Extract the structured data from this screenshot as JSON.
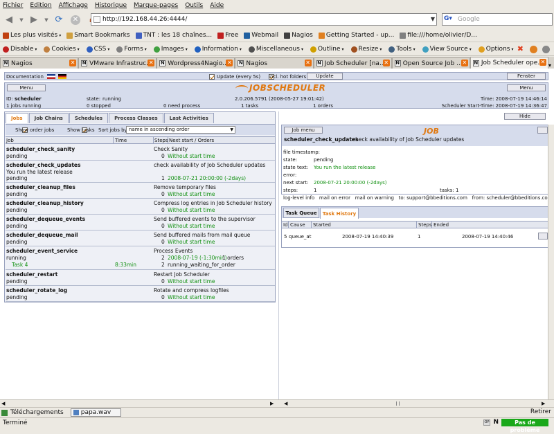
{
  "menu": [
    "Fichier",
    "Edition",
    "Affichage",
    "Historique",
    "Marque-pages",
    "Outils",
    "Aide"
  ],
  "url": "http://192.168.44.26:4444/",
  "search_placeholder": "Google",
  "bookmarks": [
    "Les plus visités",
    "Smart Bookmarks",
    "TNT : les 18 chaînes...",
    "Free",
    "Webmail",
    "Nagios",
    "Getting Started - up...",
    "file:///home/olivier/D..."
  ],
  "devbar": [
    "Disable",
    "Cookies",
    "CSS",
    "Forms",
    "Images",
    "Information",
    "Miscellaneous",
    "Outline",
    "Resize",
    "Tools",
    "View Source",
    "Options"
  ],
  "tabs": [
    "Nagios",
    "VMware Infrastruc...",
    "Wordpress4Nagio...",
    "Nagios",
    "Job Scheduler [na...",
    "Open Source Job ...",
    "Job Scheduler ope..."
  ],
  "top": {
    "documentation": "Documentation",
    "update_label": "Update (every 5s)",
    "hot_folders": "incl. hot folders",
    "update_btn": "Update",
    "fenster": "Fenster",
    "menu_btn": "Menu",
    "id_label": "ID:",
    "id_value": "scheduler",
    "state_label": "state:",
    "state_value": "running",
    "version": "2.0.206.5791 (2008-05-27 19:01:42)",
    "time_label": "Time: 2008-07-19 14:46:14",
    "jobs_running": "1 jobs running",
    "stopped": "0 stopped",
    "need_process": "0 need process",
    "tasks": "1 tasks",
    "orders": "1 orders",
    "start_time": "Scheduler Start-Time: 2008-07-19 14:36:47",
    "logo": "JOBSCHEDULER"
  },
  "hide_btn": "Hide",
  "left": {
    "tabs": [
      "Jobs",
      "Job Chains",
      "Schedules",
      "Process Classes",
      "Last Activities"
    ],
    "show_order_jobs": "Show order jobs",
    "show_tasks": "Show tasks",
    "sort_label": "Sort jobs by",
    "sort_value": "name in ascending order",
    "headers": {
      "job": "Job",
      "time": "Time",
      "steps": "Steps",
      "next": "Next start  / Orders"
    },
    "jobs": [
      {
        "name": "scheduler_check_sanity",
        "desc": "Check Sanity",
        "state": "pending",
        "steps": "0",
        "next": "Without start time"
      },
      {
        "name": "scheduler_check_updates",
        "desc": "check availability of Job Scheduler updates",
        "extra": "You run the latest release",
        "state": "pending",
        "steps": "1",
        "next": "2008-07-21  20:00:00  (-2days)"
      },
      {
        "name": "scheduler_cleanup_files",
        "desc": "Remove temporary files",
        "state": "pending",
        "steps": "0",
        "next": "Without start time"
      },
      {
        "name": "scheduler_cleanup_history",
        "desc": "Compress log entries in Job Scheduler history",
        "state": "pending",
        "steps": "0",
        "next": "Without start time"
      },
      {
        "name": "scheduler_dequeue_events",
        "desc": "Send buffered events to the supervisor",
        "state": "pending",
        "steps": "0",
        "next": "Without start time"
      },
      {
        "name": "scheduler_dequeue_mail",
        "desc": "Send buffered mails from mail queue",
        "state": "pending",
        "steps": "0",
        "next": "Without start time"
      },
      {
        "name": "scheduler_event_service",
        "desc": "Process Events",
        "state": "running",
        "steps": "2",
        "next": "2008-07-19  (-1:30min)",
        "orders": "1 orders",
        "task": "Task 4",
        "task_time": "8:33min",
        "task_steps": "2",
        "task_state": "running_waiting_for_order"
      },
      {
        "name": "scheduler_restart",
        "desc": "Restart Job Scheduler",
        "state": "pending",
        "steps": "0",
        "next": "Without start time"
      },
      {
        "name": "scheduler_rotate_log",
        "desc": "Rotate and compress logfiles",
        "state": "pending",
        "steps": "0",
        "next": "Without start time"
      }
    ]
  },
  "right": {
    "job_menu": "Job menu",
    "job_title": "JOB",
    "job_name": "scheduler_check_updates",
    "job_desc": "check availability of Job Scheduler updates",
    "file_timestamp": "file timestamp:",
    "state_label": "state:",
    "state_value": "pending",
    "state_text_label": "state text:",
    "state_text_value": "You run the latest release",
    "error_label": "error:",
    "next_start_label": "next start:",
    "next_start_value": "2008-07-21  20:00:00  (-2days)",
    "steps_label": "steps:",
    "steps_value": "1",
    "tasks_label": "tasks: 1",
    "log_level": "log-level info",
    "mail_on_error": "mail on error",
    "mail_on_warning": "mail on warning",
    "to": "to: support@bbeditions.com",
    "from": "from: scheduler@bbeditions.com",
    "smtp": "smtp",
    "tabs": [
      "Task Queue",
      "Task History"
    ],
    "history_headers": {
      "id": "Id",
      "cause": "Cause",
      "started": "Started",
      "steps": "Steps",
      "ended": "Ended"
    },
    "history": [
      {
        "id": "5",
        "cause": "queue_at",
        "started": "2008-07-19 14:40:39",
        "steps": "1",
        "ended": "2008-07-19 14:40:46"
      }
    ]
  },
  "downloads": {
    "label": "Téléchargements",
    "file": "papa.wav",
    "retry": "Retirer"
  },
  "status": {
    "text": "Terminé",
    "problem": "Pas de problème"
  }
}
